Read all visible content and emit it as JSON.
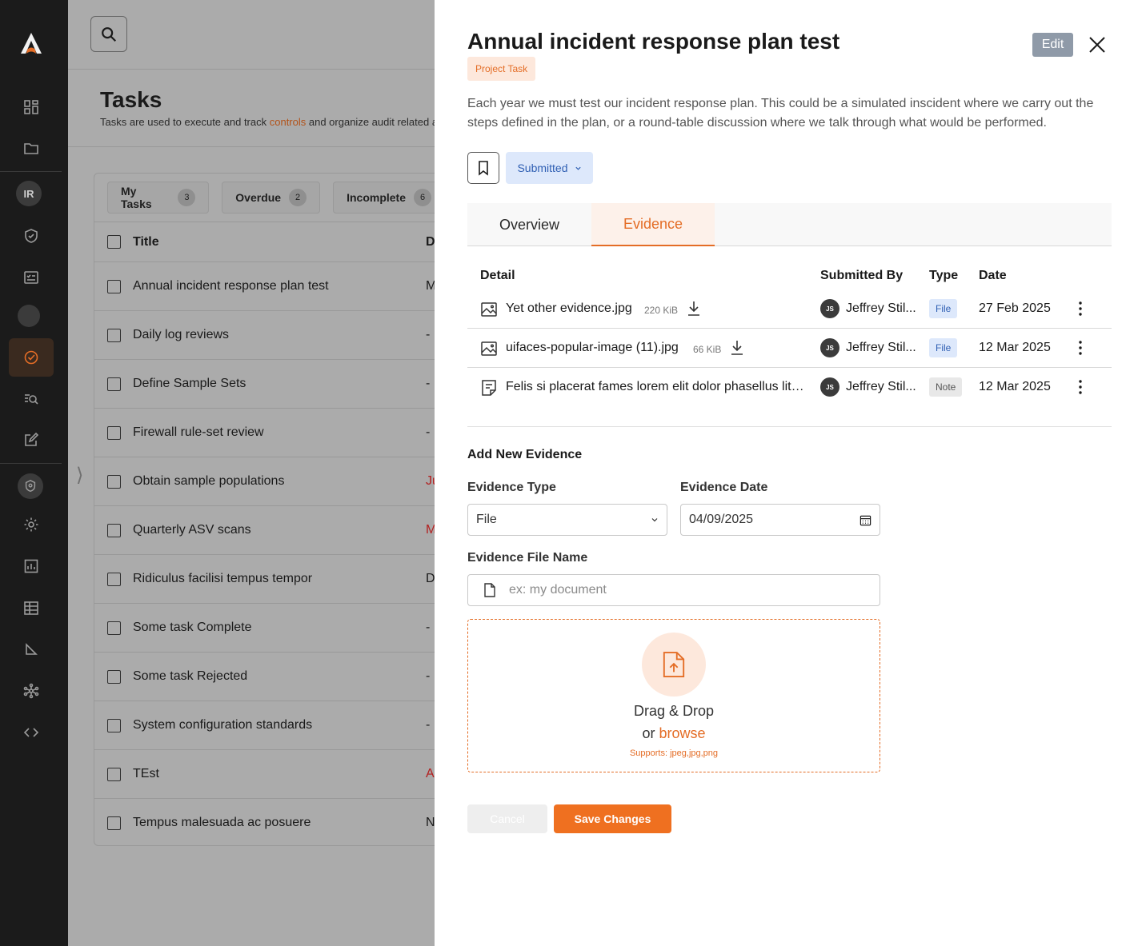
{
  "sidebar": {
    "avatar_initials": "IR",
    "icons": [
      "logo-icon",
      "dashboard-icon",
      "folder-icon",
      "shield-check-icon",
      "checklist-icon",
      "tasks-icon",
      "audit-search-icon",
      "edit-icon",
      "privacy-shield-icon",
      "gear-icon",
      "reports-icon",
      "building-icon",
      "ruler-icon",
      "network-icon",
      "code-icon"
    ],
    "accent_color": "#e46d26"
  },
  "tasks_page": {
    "title": "Tasks",
    "subtitle_prefix": "Tasks are used to execute and track ",
    "subtitle_link": "controls",
    "subtitle_suffix": " and organize audit related a",
    "filters": [
      {
        "label": "My Tasks",
        "count": "3"
      },
      {
        "label": "Overdue",
        "count": "2"
      },
      {
        "label": "Incomplete",
        "count": "6"
      }
    ],
    "header": {
      "title": "Title",
      "d": "D"
    },
    "rows": [
      {
        "title": "Annual incident response plan test",
        "d": "M",
        "red": false
      },
      {
        "title": "Daily log reviews",
        "d": "-",
        "red": false
      },
      {
        "title": "Define Sample Sets",
        "d": "-",
        "red": false
      },
      {
        "title": "Firewall rule-set review",
        "d": "-",
        "red": false
      },
      {
        "title": "Obtain sample populations",
        "d": "Ju",
        "red": true
      },
      {
        "title": "Quarterly ASV scans",
        "d": "M",
        "red": true
      },
      {
        "title": "Ridiculus facilisi tempus tempor",
        "d": "D",
        "red": false
      },
      {
        "title": "Some task Complete",
        "d": "-",
        "red": false
      },
      {
        "title": "Some task Rejected",
        "d": "-",
        "red": false
      },
      {
        "title": "System configuration standards",
        "d": "-",
        "red": false
      },
      {
        "title": "TEst",
        "d": "A",
        "red": true
      },
      {
        "title": "Tempus malesuada ac posuere",
        "d": "N",
        "red": false
      }
    ]
  },
  "panel": {
    "title": "Annual incident response plan test",
    "badge": "Project Task",
    "edit_label": "Edit",
    "description": "Each year we must test our incident response plan. This could be a simulated inscident where we carry out the steps defined in the plan, or a round-table discussion where we talk through what would be performed.",
    "status": "Submitted",
    "tabs": [
      "Overview",
      "Evidence"
    ],
    "active_tab": "Evidence",
    "evidence": {
      "headers": {
        "detail": "Detail",
        "submitted_by": "Submitted By",
        "type": "Type",
        "date": "Date"
      },
      "rows": [
        {
          "icon": "image-icon",
          "name": "Yet other evidence.jpg",
          "size": "220 KiB",
          "initials": "JS",
          "by": "Jeffrey Stil...",
          "type": "File",
          "date": "27 Feb 2025"
        },
        {
          "icon": "image-icon",
          "name": "uifaces-popular-image (11).jpg",
          "size": "66 KiB",
          "initials": "JS",
          "by": "Jeffrey Stil...",
          "type": "File",
          "date": "12 Mar 2025"
        },
        {
          "icon": "note-icon",
          "name": "Felis si placerat fames lorem elit dolor phasellus litora",
          "size": "",
          "initials": "JS",
          "by": "Jeffrey Stil...",
          "type": "Note",
          "date": "12 Mar 2025"
        }
      ]
    },
    "add_new": {
      "title": "Add New Evidence",
      "type_label": "Evidence Type",
      "type_value": "File",
      "date_label": "Evidence Date",
      "date_value": "04/09/2025",
      "filename_label": "Evidence File Name",
      "filename_placeholder": "ex: my document",
      "drop_line1": "Drag & Drop",
      "drop_or": "or ",
      "drop_browse": "browse",
      "supports": "Supports: jpeg,jpg,png"
    },
    "cancel_label": "Cancel",
    "save_label": "Save Changes"
  }
}
